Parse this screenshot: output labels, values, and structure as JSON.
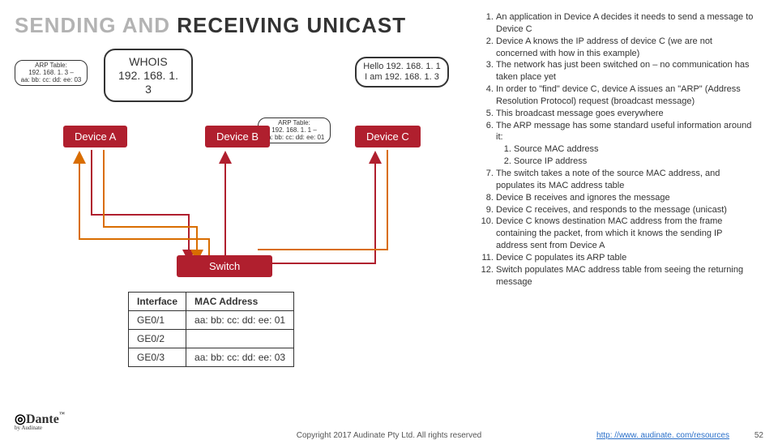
{
  "title_grey": "SENDING AND ",
  "title_dark": "RECEIVING UNICAST",
  "callouts": {
    "whois_line1": "WHOIS",
    "whois_line2": "192. 168. 1. 3",
    "hello": "Hello 192. 168. 1. 1 I am 192. 168. 1. 3",
    "arp_a_title": "ARP Table:",
    "arp_a_ip": "192. 168. 1. 3 –",
    "arp_a_mac": "aa: bb: cc: dd: ee: 03",
    "arp_c_title": "ARP Table:",
    "arp_c_ip": "192. 168. 1. 1 –",
    "arp_c_mac": "aa: bb: cc: dd: ee: 01"
  },
  "devices": {
    "a": "Device A",
    "b": "Device B",
    "c": "Device C"
  },
  "switch": "Switch",
  "mac_table": {
    "headers": [
      "Interface",
      "MAC Address"
    ],
    "rows": [
      {
        "iface": "GE0/1",
        "mac": "aa: bb: cc: dd: ee: 01"
      },
      {
        "iface": "GE0/2",
        "mac": ""
      },
      {
        "iface": "GE0/3",
        "mac": "aa: bb: cc: dd: ee: 03"
      }
    ]
  },
  "steps": [
    "An application in Device A decides it needs to send a message to Device C",
    "Device A knows the IP address of device C (we are not concerned with how in this example)",
    "The network has just been switched on – no communication has taken place yet",
    "In order to \"find\" device C, device A issues an \"ARP\" (Address Resolution Protocol) request (broadcast message)",
    "This broadcast message goes everywhere",
    "The ARP message has some standard useful information around it:",
    "The switch takes a note of the source MAC address, and populates its MAC address table",
    "Device B receives and ignores the message",
    "Device C receives, and responds to the message (unicast)",
    "Device C knows destination MAC address from the frame containing the packet, from which it knows the sending IP address sent from Device A",
    "Device C populates its ARP table",
    "Switch populates MAC address table from seeing the returning message"
  ],
  "substeps6": [
    "Source MAC address",
    "Source IP address"
  ],
  "footer": {
    "copyright": "Copyright 2017 Audinate Pty Ltd. All rights reserved",
    "link_text": "http: //www. audinate. com/resources",
    "page": "52",
    "brand": "Dante",
    "byline": "by Audinate"
  },
  "colors": {
    "red": "#b01f2e"
  }
}
